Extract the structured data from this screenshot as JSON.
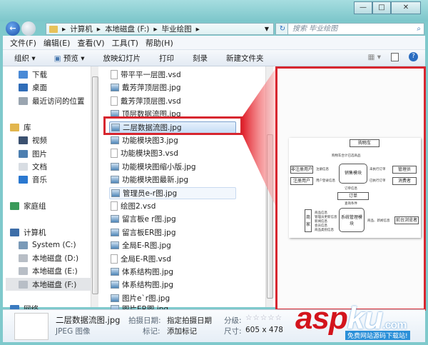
{
  "window": {
    "controls": [
      "—",
      "□",
      "✕"
    ]
  },
  "address": {
    "crumbs": [
      "计算机",
      "本地磁盘 (F:)",
      "毕业绘图"
    ],
    "search_placeholder": "搜索 毕业绘图"
  },
  "menu": [
    "文件(F)",
    "编辑(E)",
    "查看(V)",
    "工具(T)",
    "帮助(H)"
  ],
  "toolbar": {
    "organize": "组织 ▾",
    "preview": "预览 ▾",
    "slideshow": "放映幻灯片",
    "print": "打印",
    "burn": "刻录",
    "new_folder": "新建文件夹"
  },
  "nav": [
    {
      "label": "下载",
      "icon": "download-folder-icon",
      "color": "#4a8ad6"
    },
    {
      "label": "桌面",
      "icon": "desktop-icon",
      "color": "#2f6db8"
    },
    {
      "label": "最近访问的位置",
      "icon": "recent-places-icon",
      "color": "#9aa5b0"
    },
    {
      "label": "库",
      "icon": "library-icon",
      "color": "#e2b64e"
    },
    {
      "label": "视频",
      "icon": "video-icon",
      "color": "#3b5170"
    },
    {
      "label": "图片",
      "icon": "pictures-icon",
      "color": "#4d7fb0"
    },
    {
      "label": "文档",
      "icon": "documents-icon",
      "color": "#d8dde3"
    },
    {
      "label": "音乐",
      "icon": "music-icon",
      "color": "#2a78d0"
    },
    {
      "label": "家庭组",
      "icon": "homegroup-icon",
      "color": "#3a9a5a"
    },
    {
      "label": "计算机",
      "icon": "computer-icon",
      "color": "#3d6ea8"
    },
    {
      "label": "System (C:)",
      "icon": "system-drive-icon",
      "color": "#7a9ab8"
    },
    {
      "label": "本地磁盘 (D:)",
      "icon": "drive-icon",
      "color": "#b8bec6"
    },
    {
      "label": "本地磁盘 (E:)",
      "icon": "drive-icon",
      "color": "#b8bec6"
    },
    {
      "label": "本地磁盘 (F:)",
      "icon": "drive-icon",
      "color": "#b8bec6"
    },
    {
      "label": "网络",
      "icon": "network-icon",
      "color": "#3a7ac0"
    }
  ],
  "files": [
    {
      "name": "带平平一层图.vsd",
      "type": "vsd"
    },
    {
      "name": "戴芳萍顶层图.jpg",
      "type": "jpg"
    },
    {
      "name": "戴芳萍顶层图.vsd",
      "type": "vsd"
    },
    {
      "name": "顶层数据流图.jpg",
      "type": "jpg"
    },
    {
      "name": "二层数据流图.jpg",
      "type": "jpg",
      "state": "selected"
    },
    {
      "name": "功能模块图3.jpg",
      "type": "jpg"
    },
    {
      "name": "功能模块图3.vsd",
      "type": "vsd"
    },
    {
      "name": "功能模块图缩小版.jpg",
      "type": "jpg"
    },
    {
      "name": "功能模块图最新.jpg",
      "type": "jpg"
    },
    {
      "name": "管理员e-r图.jpg",
      "type": "jpg",
      "state": "hover"
    },
    {
      "name": "绘图2.vsd",
      "type": "vsd"
    },
    {
      "name": "留言板e r图.jpg",
      "type": "jpg"
    },
    {
      "name": "留言板ER图.jpg",
      "type": "jpg"
    },
    {
      "name": "全局E-R图.jpg",
      "type": "jpg"
    },
    {
      "name": "全局E-R图.vsd",
      "type": "vsd"
    },
    {
      "name": "体系结构图.jpg",
      "type": "jpg"
    },
    {
      "name": "体系结构图.jpg",
      "type": "jpg"
    },
    {
      "name": "图片e`r图.jpg",
      "type": "jpg"
    },
    {
      "name": "图片ER图.jpg",
      "type": "jpg"
    }
  ],
  "preview_diagram": {
    "cart": "购物车",
    "cart_flow": "购物车合计已选商品",
    "sales": "销售模块",
    "unreg": "非注册用户",
    "reg": "注册用户",
    "unreg_flow": "注册信息",
    "reg_flow": "用户登录信息",
    "admin": "管理员",
    "consumer": "消费者",
    "admin_flow": "未执行订单",
    "consumer_flow": "已执行订单",
    "order_flow": "订单信息",
    "order": "订单",
    "query_flow": "查询条件",
    "merchant": "商家",
    "system": "系统管理模块",
    "browser": "前台浏览者",
    "browser_flow": "商品、新闻信息",
    "merchant_flows": [
      "商品信息",
      "管理员更新信息",
      "新闻信息",
      "会员信息",
      "商品类别信息"
    ]
  },
  "details": {
    "filename": "二层数据流图.jpg",
    "filetype": "JPEG 图像",
    "date_label": "拍摄日期:",
    "date_value": "指定拍摄日期",
    "tags_label": "标记:",
    "tags_value": "添加标记",
    "rating_label": "分级:",
    "rating": 0,
    "rating_max": 5,
    "size_label": "尺寸:",
    "size_value": "605 x 478"
  },
  "watermark": {
    "logo": "aspku",
    "domain": ".com",
    "tagline": "免费网站源码下载站!"
  },
  "colors": {
    "highlight": "#d7262f",
    "frame": "#7fc9cc"
  }
}
